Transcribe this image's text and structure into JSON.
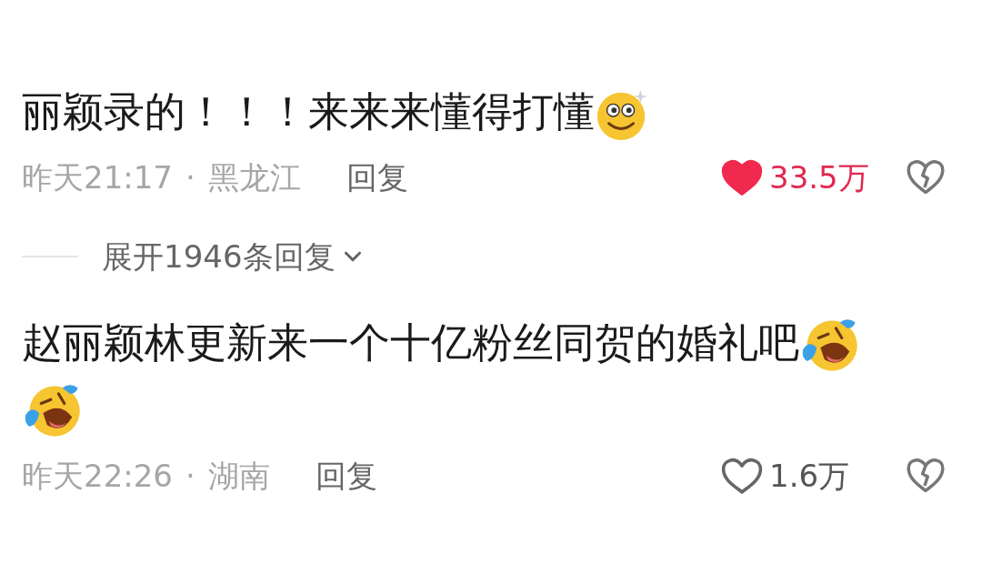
{
  "comments": [
    {
      "text": "丽颖录的！！！来来来懂得打懂",
      "emojis": [
        {
          "kind": "dizzy"
        }
      ],
      "time": "昨天21:17",
      "separator": "·",
      "location": "黑龙江",
      "reply": "回复",
      "liked": true,
      "likes": "33.5万",
      "expand": "展开1946条回复"
    },
    {
      "text": "赵丽颖林更新来一个十亿粉丝同贺的婚礼吧",
      "emojis": [
        {
          "kind": "laugh"
        },
        {
          "kind": "laugh"
        }
      ],
      "time": "昨天22:26",
      "separator": "·",
      "location": "湖南",
      "reply": "回复",
      "liked": false,
      "likes": "1.6万"
    }
  ]
}
